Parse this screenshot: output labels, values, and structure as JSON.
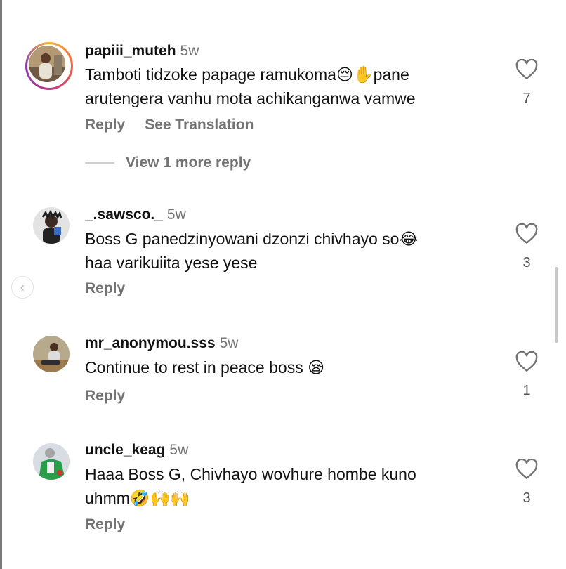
{
  "comments": [
    {
      "username": "papiii_muteh",
      "time": "5w",
      "line1": "Tamboti tidzoke papage ramukoma😔✋pane",
      "line2": "arutengera vanhu mota achikanganwa vamwe",
      "likes": "7",
      "reply": "Reply",
      "see_translation": "See Translation",
      "view_more": "View 1 more reply"
    },
    {
      "username": "_.sawsco._",
      "time": "5w",
      "line1": "Boss G panedzinyowani dzonzi chivhayo so😂",
      "line2": "haa varikuiita yese yese",
      "likes": "3",
      "reply": "Reply"
    },
    {
      "username": "mr_anonymou.sss",
      "time": "5w",
      "line1": "Continue to rest in peace boss 😪",
      "likes": "1",
      "reply": "Reply"
    },
    {
      "username": "uncle_keag",
      "time": "5w",
      "line1": "Haaa Boss G, Chivhayo wovhure hombe kuno",
      "line2": "uhmm🤣🙌🙌",
      "likes": "3",
      "reply": "Reply"
    }
  ],
  "icons": {
    "like": "heart-outline-icon",
    "scroll_left": "chevron-left-icon"
  }
}
